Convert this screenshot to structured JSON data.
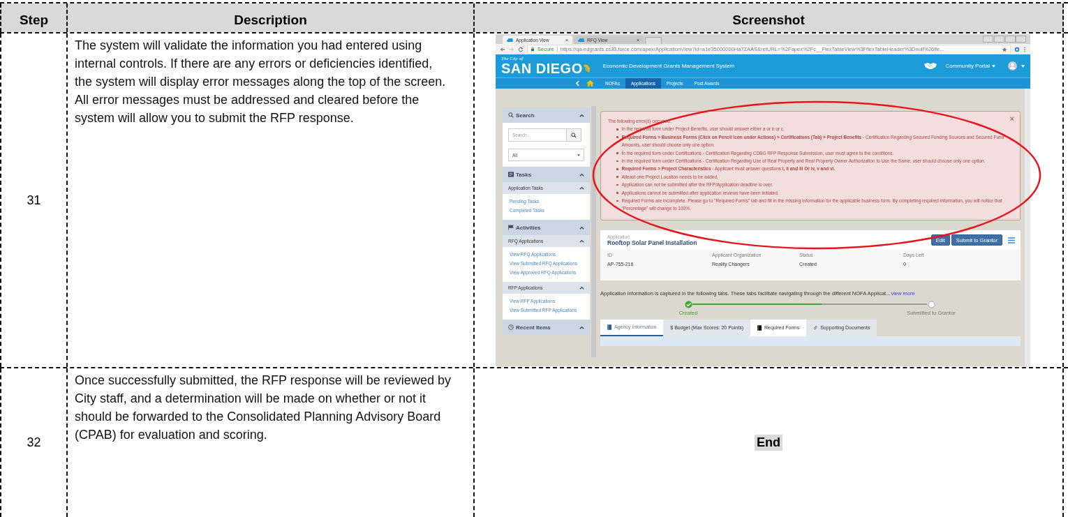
{
  "table": {
    "columns": [
      "Step",
      "Description",
      "Screenshot"
    ],
    "rows": [
      {
        "step": "31",
        "description": "The system will validate the information you had entered using internal controls. If there are any errors or deficiencies identified, the system will display error messages along the top of the screen. All error messages must be addressed and cleared before the system will allow you to submit the RFP response.",
        "screenshot": {
          "browser_tabs": [
            {
              "title": "Application View",
              "close": "×",
              "selected": true
            },
            {
              "title": "RFQ View",
              "close": "×",
              "selected": false
            }
          ],
          "address_bar": {
            "secure_label": "Secure",
            "url": "https://qa-edgrants.cs33.force.com/apex/ApplicationView?id=a1e35000000Ha7ZAAS&retURL=%2Fapex%2Fc__FlexTableView%3FflexTableHeader%3Dnull%26fle..."
          },
          "header": {
            "logo_small": "The City of",
            "logo_large": "SAN DIEGO",
            "title": "Economic Development Grants Management System",
            "portal_menu": "Community Portal"
          },
          "nav": [
            {
              "label": "NOFAs",
              "selected": false
            },
            {
              "label": "Applications",
              "selected": true
            },
            {
              "label": "Projects",
              "selected": false
            },
            {
              "label": "Post Awards",
              "selected": false
            }
          ],
          "sidebar": {
            "search": {
              "title": "Search",
              "placeholder": "Search...",
              "filter": "All"
            },
            "sections": [
              {
                "title": "Tasks",
                "groups": [
                  {
                    "title": "Application Tasks",
                    "links": [
                      "Pending Tasks",
                      "Completed Tasks"
                    ]
                  }
                ]
              },
              {
                "title": "Activities",
                "groups": [
                  {
                    "title": "RFQ Applications",
                    "links": [
                      "View RFQ Applications",
                      "View Submitted RFQ Applications",
                      "View Approved RFQ Applications"
                    ]
                  },
                  {
                    "title": "RFP Applications",
                    "links": [
                      "View RFP Applications",
                      "View Submitted RFP Applications"
                    ]
                  }
                ]
              },
              {
                "title": "Recent Items"
              }
            ]
          },
          "errors": {
            "heading": "The following error(s) occurred:",
            "close": "×",
            "items": [
              "In the required form under Project Benefits, user should answer either a or b or c.",
              "**Required Forms > Business Forms (Click on Pencil Icon under Actions) > Certifications (Tab) > Project Benefits** - Certification Regarding Secured Funding Sources and Secured Fund Amounts, user should choose only one option.",
              "In the required form under Certifications - Certification Regarding CDBG RFP Response Submission, user must agree to the conditions.",
              "In the required form under Certifications - Certification Regarding Use of Real Property and Real Property Owner Authorization to Use the Same, user should choose only one option.",
              "**Required Forms > Project Characteristics** - Applicant must answer questions **i, ii and iii Or iv, v and vi.**",
              "Atleast one Project Location needs to be added.",
              "Application can not be submitted after the RFP/Application deadline is over.",
              "Applications cannot be submitted after application reviews have been initiated.",
              "Required Forms are incomplete. Please go to \"Required Forms\" tab and fill in the missing information for the applicable business form. By completing required information, you will notice that \"Percentage\" will change to 100%."
            ]
          },
          "application": {
            "label": "Application",
            "name": "Rooftop Solar Panel Installation",
            "buttons": [
              "Edit",
              "Submit to Grantor"
            ],
            "fields": [
              {
                "label": "ID",
                "value": "AP-755-216"
              },
              {
                "label": "Applicant Organization",
                "value": "Reality Changers"
              },
              {
                "label": "Status",
                "value": "Created"
              },
              {
                "label": "Days Left",
                "value": "0"
              }
            ]
          },
          "info": {
            "text": "Application information is captured in the following tabs. These tabs facilitate navigating through the different NOFA Applicat...",
            "link": "view more"
          },
          "progress": [
            {
              "label": "Created",
              "done": true
            },
            {
              "label": "Submitted to Grantor",
              "done": false
            }
          ],
          "tabs": [
            {
              "label": "Agency Information",
              "selected": true
            },
            {
              "label": "$ Budget (Max Scores: 20 Points)",
              "selected": false
            },
            {
              "label": "Required Forms",
              "selected": false
            },
            {
              "label": "Supporting Documents",
              "selected": false
            }
          ]
        }
      },
      {
        "step": "32",
        "description": "Once successfully submitted, the RFP response will be reviewed by City staff, and a determination will be made on whether or not it should be forwarded to the Consolidated Planning Advisory Board (CPAB) for evaluation and scoring.",
        "end_label": "End"
      }
    ]
  }
}
